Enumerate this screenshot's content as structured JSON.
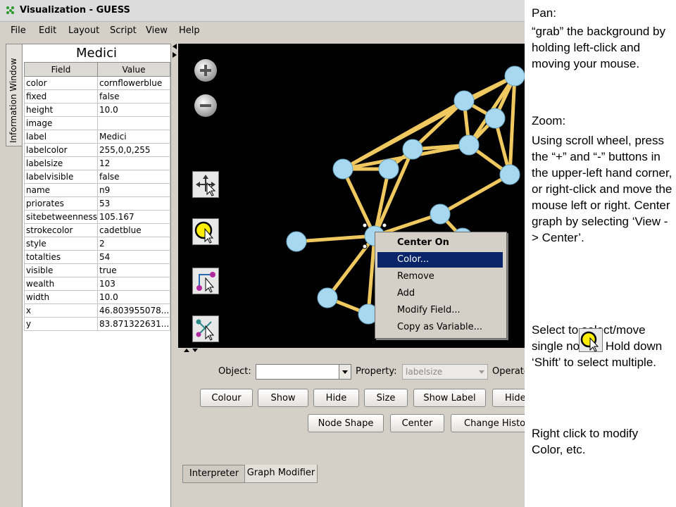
{
  "window": {
    "title": "Visualization - GUESS",
    "menu": [
      "File",
      "Edit",
      "Layout",
      "Script",
      "View",
      "Help"
    ]
  },
  "info_panel": {
    "tab_label": "Information Window",
    "heading": "Medici",
    "columns": [
      "Field",
      "Value"
    ],
    "rows": [
      [
        "color",
        "cornflowerblue"
      ],
      [
        "fixed",
        "false"
      ],
      [
        "height",
        "10.0"
      ],
      [
        "image",
        ""
      ],
      [
        "label",
        "Medici"
      ],
      [
        "labelcolor",
        "255,0,0,255"
      ],
      [
        "labelsize",
        "12"
      ],
      [
        "labelvisible",
        "false"
      ],
      [
        "name",
        "n9"
      ],
      [
        "priorates",
        "53"
      ],
      [
        "sitebetweenness",
        "105.167"
      ],
      [
        "strokecolor",
        "cadetblue"
      ],
      [
        "style",
        "2"
      ],
      [
        "totalties",
        "54"
      ],
      [
        "visible",
        "true"
      ],
      [
        "wealth",
        "103"
      ],
      [
        "width",
        "10.0"
      ],
      [
        "x",
        "46.803955078..."
      ],
      [
        "y",
        "83.871322631..."
      ]
    ]
  },
  "graph": {
    "zoom_in_label": "+",
    "zoom_out_label": "−",
    "node_color": "#a8d8f0",
    "edge_color": "#f0c860",
    "background": "#000000"
  },
  "context_menu": {
    "items": [
      "Center On",
      "Color...",
      "Remove",
      "Add",
      "Modify Field...",
      "Copy as Variable..."
    ],
    "selected_index": 1
  },
  "graph_modifier": {
    "object_label": "Object:",
    "object_value": "",
    "property_label": "Property:",
    "property_value": "labelsize",
    "operator_label": "Operato",
    "row1_buttons": [
      "Colour",
      "Show",
      "Hide",
      "Size",
      "Show Label",
      "Hide"
    ],
    "row2_buttons": [
      "Node Shape",
      "Center",
      "Change History"
    ]
  },
  "bottom_tabs": [
    "Interpreter",
    "Graph Modifier"
  ],
  "notes": {
    "pan_title": "Pan:",
    "pan_text": "“grab” the background by holding left-click and moving your mouse.",
    "zoom_title": "Zoom:",
    "zoom_text": "Using scroll wheel, press the “+” and “-” buttons in the upper-left hand corner, or right-click and move the mouse left or right. Center graph by selecting ‘View -> Center’.",
    "select_text": "Select        to select/move single nodes. Hold down ‘Shift’ to select multiple.",
    "right_click_text": "Right click to modify Color, etc."
  }
}
